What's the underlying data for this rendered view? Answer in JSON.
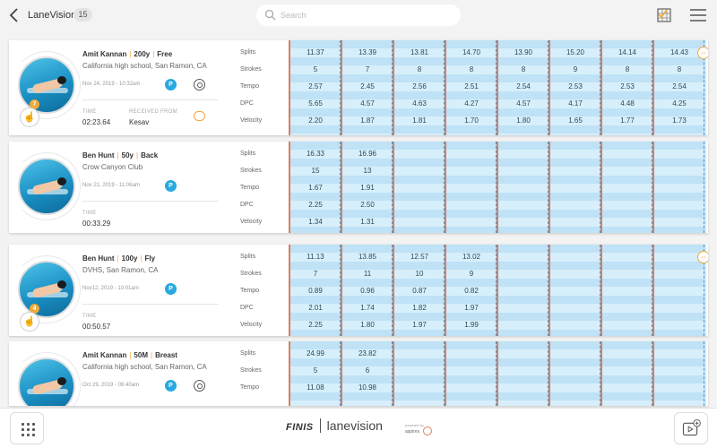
{
  "header": {
    "back_icon": "chevron-left-icon",
    "title": "LaneVision",
    "count": "15",
    "search_placeholder": "Search",
    "checklist_icon": "checklist-grid-icon",
    "menu_icon": "hamburger-menu-icon"
  },
  "metric_labels": [
    "Splits",
    "Strokes",
    "Tempo",
    "DPC",
    "Velocity"
  ],
  "labels": {
    "time": "TIME",
    "received_from": "RECEIVED FROM"
  },
  "sessions": [
    {
      "swimmer": "Amit Kannan",
      "distance": "200y",
      "stroke": "Free",
      "club": "California high school, San Ramon, CA",
      "date": "Nov 24, 2019 - 10:32am",
      "p_badge": "P",
      "time": "02:23.64",
      "received_from": "Kesav",
      "annotation_count": "7",
      "metrics": {
        "splits": [
          "11.37",
          "13.39",
          "13.81",
          "14.70",
          "13.90",
          "15.20",
          "14.14",
          "14.43"
        ],
        "strokes": [
          "5",
          "7",
          "8",
          "8",
          "8",
          "9",
          "8",
          "8"
        ],
        "tempo": [
          "2.57",
          "2.45",
          "2.56",
          "2.51",
          "2.54",
          "2.53",
          "2.53",
          "2.54"
        ],
        "dpc": [
          "5.65",
          "4.57",
          "4.63",
          "4.27",
          "4.57",
          "4.17",
          "4.48",
          "4.25"
        ],
        "velocity": [
          "2.20",
          "1.87",
          "1.81",
          "1.70",
          "1.80",
          "1.65",
          "1.77",
          "1.73"
        ]
      }
    },
    {
      "swimmer": "Ben Hunt",
      "distance": "50y",
      "stroke": "Back",
      "club": "Crow Canyon Club",
      "date": "Nov 21, 2019 - 11:06am",
      "p_badge": "P",
      "time": "00:33.29",
      "metrics": {
        "splits": [
          "16.33",
          "16.96"
        ],
        "strokes": [
          "15",
          "13"
        ],
        "tempo": [
          "1.67",
          "1.91"
        ],
        "dpc": [
          "2.25",
          "2.50"
        ],
        "velocity": [
          "1.34",
          "1.31"
        ]
      }
    },
    {
      "swimmer": "Ben Hunt",
      "distance": "100y",
      "stroke": "Fly",
      "club": "DVHS, San Ramon, CA",
      "date": "Nov12, 2019 - 10:01am",
      "p_badge": "P",
      "time": "00:50.57",
      "annotation_count": "4",
      "metrics": {
        "splits": [
          "11.13",
          "13.85",
          "12.57",
          "13.02"
        ],
        "strokes": [
          "7",
          "11",
          "10",
          "9"
        ],
        "tempo": [
          "0.89",
          "0.96",
          "0.87",
          "0.82"
        ],
        "dpc": [
          "2.01",
          "1.74",
          "1.82",
          "1.97"
        ],
        "velocity": [
          "2.25",
          "1.80",
          "1.97",
          "1.99"
        ]
      }
    },
    {
      "swimmer": "Amit Kannan",
      "distance": "50M",
      "stroke": "Breast",
      "club": "California high school, San Ramon, CA",
      "date": "Oct 29, 2019 - 09:40am",
      "p_badge": "P",
      "metrics": {
        "splits": [
          "24.99",
          "23.82"
        ],
        "strokes": [
          "5",
          "6"
        ],
        "tempo": [
          "11.08",
          "10.98"
        ]
      }
    }
  ],
  "footer": {
    "grid_icon": "app-grid-icon",
    "brand_finis": "FINIS",
    "brand_name": "lanevision",
    "brand_partner": "powered by",
    "brand_asp": "aspirex",
    "video_icon": "add-video-icon"
  },
  "colors": {
    "accent": "#f2a93b",
    "badge_blue": "#2aa8e0",
    "lane_rope": "#e07c5a",
    "lane_water": "#cfe9f8"
  }
}
